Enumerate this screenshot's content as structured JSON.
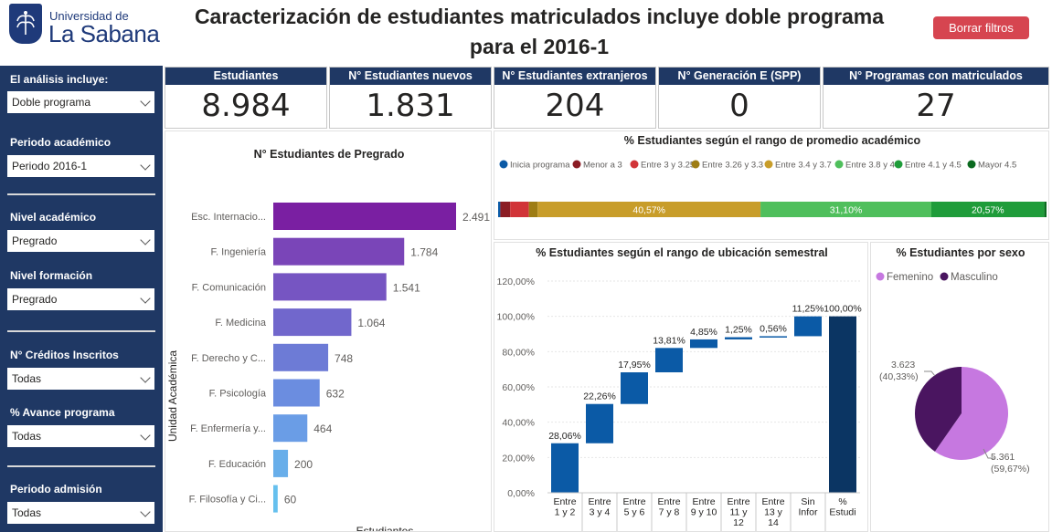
{
  "header": {
    "logo_line1": "Universidad de",
    "logo_line2": "La Sabana",
    "title": "Caracterización de estudiantes matriculados incluye doble programa para el 2016-1",
    "clear_button": "Borrar filtros"
  },
  "filters": [
    {
      "label": "El análisis incluye:",
      "value": "Doble programa"
    },
    {
      "label": "Periodo académico",
      "value": "Periodo 2016-1"
    },
    {
      "label": "Nivel académico",
      "value": "Pregrado"
    },
    {
      "label": "Nivel formación",
      "value": "Pregrado"
    },
    {
      "label": "N° Créditos Inscritos",
      "value": "Todas"
    },
    {
      "label": "% Avance programa",
      "value": "Todas"
    },
    {
      "label": "Periodo admisión",
      "value": "Todas"
    }
  ],
  "kpis": [
    {
      "label": "Estudiantes",
      "value": "8.984"
    },
    {
      "label": "N° Estudiantes nuevos",
      "value": "1.831"
    },
    {
      "label": "N° Estudiantes extranjeros",
      "value": "204"
    },
    {
      "label": "N° Generación E (SPP)",
      "value": "0"
    },
    {
      "label": "N° Programas con matriculados",
      "value": "27"
    }
  ],
  "colors": {
    "navy": "#1f3864",
    "clear_button": "#d64550",
    "bar_purple": "#7a1fa2",
    "waterfall": "#0b5aa6",
    "waterfall_total": "#0b3563",
    "pie_femenino": "#c678e0",
    "pie_masculino": "#4a1560"
  },
  "chart_data": [
    {
      "type": "bar",
      "title": "N° Estudiantes de Pregrado",
      "ylabel": "Unidad Académica",
      "xlabel": "Estudiantes",
      "categories": [
        "Esc. Internacio...",
        "F. Ingeniería",
        "F. Comunicación",
        "F. Medicina",
        "F. Derecho y C...",
        "F. Psicología",
        "F. Enfermería y...",
        "F. Educación",
        "F. Filosofía y Ci..."
      ],
      "values": [
        2491,
        1784,
        1541,
        1064,
        748,
        632,
        464,
        200,
        60
      ],
      "value_labels": [
        "2.491",
        "1.784",
        "1.541",
        "1.064",
        "748",
        "632",
        "464",
        "200",
        "60"
      ],
      "colors": [
        "#7a1fa2",
        "#7a45b8",
        "#7655c2",
        "#7167cc",
        "#6d7bd6",
        "#6b8de0",
        "#6a9de6",
        "#68aeea",
        "#66c0ee"
      ]
    },
    {
      "type": "bar",
      "title": "% Estudiantes según el rango de promedio académico",
      "legend": [
        "Inicia programa",
        "Menor a 3",
        "Entre 3 y 3.25",
        "Entre 3.26 y 3.3",
        "Entre 3.4 y 3.7",
        "Entre 3.8 y 4",
        "Entre 4.1 y 4.5",
        "Mayor 4.5"
      ],
      "legend_colors": [
        "#0b5aa6",
        "#8b1c24",
        "#d13438",
        "#9e7d14",
        "#c89d2a",
        "#4fbf5c",
        "#1f9c3a",
        "#0b6a1f"
      ],
      "values": [
        0.4,
        1.8,
        3.4,
        1.6,
        40.57,
        31.1,
        20.57,
        0.4
      ],
      "data_labels": [
        "",
        "",
        "",
        "",
        "40,57%",
        "31,10%",
        "20,57%",
        ""
      ]
    },
    {
      "type": "bar",
      "title": "% Estudiantes según el rango de ubicación semestral",
      "categories": [
        [
          "Entre",
          "1 y 2"
        ],
        [
          "Entre",
          "3 y 4"
        ],
        [
          "Entre",
          "5 y 6"
        ],
        [
          "Entre",
          "7 y 8"
        ],
        [
          "Entre",
          "9 y 10"
        ],
        [
          "Entre",
          "11 y",
          "12"
        ],
        [
          "Entre",
          "13 y",
          "14"
        ],
        [
          "Sin",
          "Infor"
        ],
        [
          "%",
          "Estudi"
        ]
      ],
      "values": [
        28.06,
        22.26,
        17.95,
        13.81,
        4.85,
        1.25,
        0.56,
        11.25,
        100.0
      ],
      "value_labels": [
        "28,06%",
        "22,26%",
        "17,95%",
        "13,81%",
        "4,85%",
        "1,25%",
        "0,56%",
        "11,25%",
        "100,00%"
      ],
      "ylim": [
        0,
        120
      ],
      "yticks": [
        "0,00%",
        "20,00%",
        "40,00%",
        "60,00%",
        "80,00%",
        "100,00%",
        "120,00%"
      ]
    },
    {
      "type": "pie",
      "title": "% Estudiantes por sexo",
      "legend": [
        "Femenino",
        "Masculino"
      ],
      "values": [
        5361,
        3623
      ],
      "value_labels": [
        "5.361",
        "3.623"
      ],
      "percent_labels": [
        "(59,67%)",
        "(40,33%)"
      ]
    }
  ]
}
